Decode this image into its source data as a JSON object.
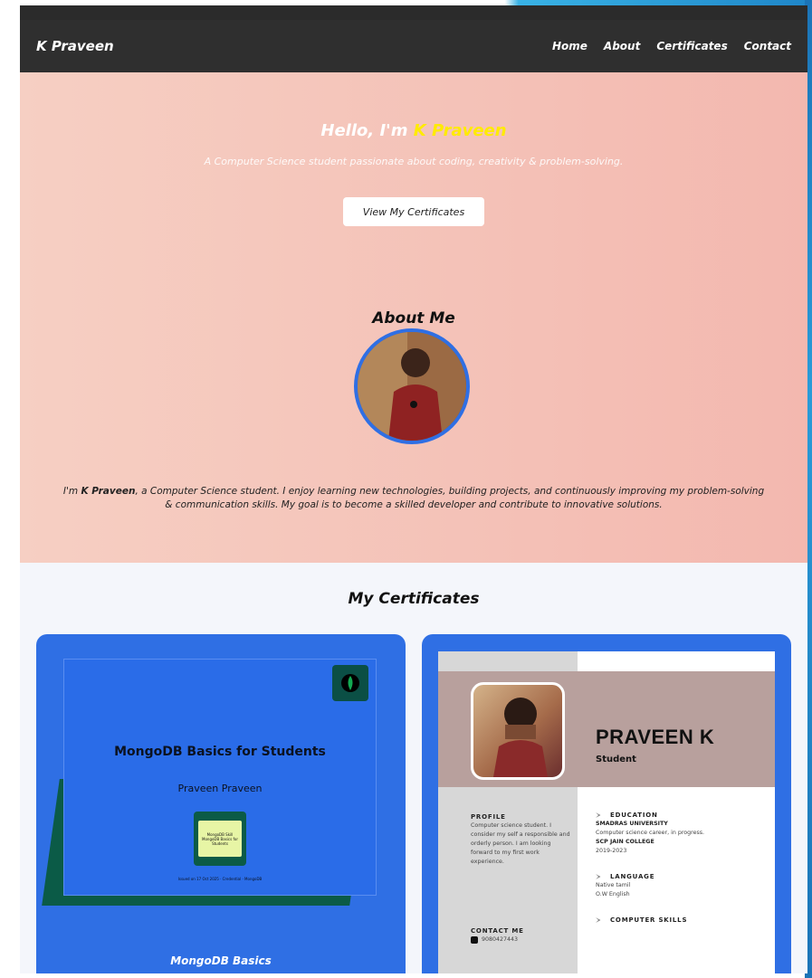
{
  "nav": {
    "brand": "K Praveen",
    "links": [
      "Home",
      "About",
      "Certificates",
      "Contact"
    ]
  },
  "hero": {
    "greeting": "Hello, I'm",
    "name": "K Praveen",
    "subtitle": "A Computer Science student passionate about coding, creativity & problem-solving.",
    "cta_label": "View My Certificates"
  },
  "about": {
    "title": "About Me",
    "text_intro": "I'm",
    "text_name": "K Praveen",
    "text_rest": ", a Computer Science student. I enjoy learning new technologies, building projects, and continuously improving my problem-solving & communication skills. My goal is to become a skilled developer and contribute to innovative solutions."
  },
  "certificates": {
    "title": "My Certificates",
    "mongo": {
      "certificate_title": "MongoDB Basics for Students",
      "recipient": "Praveen Praveen",
      "badge_header": "MongoDB Skill",
      "badge_text": "MongoDB Basics for Students",
      "fine_print": "Issued on 17 Oct 2025 · Credential · MongoDB",
      "card_label": "MongoDB Basics"
    },
    "resume": {
      "name": "PRAVEEN K",
      "role": "Student",
      "profile_heading": "PROFILE",
      "profile_text": "Computer science student. I consider my self a responsible and orderly person. I am looking forward to my first work experience.",
      "contact_heading": "CONTACT ME",
      "phone": "9080427443",
      "education_heading": "EDUCATION",
      "education_school": "SMADRAS UNIVERSITY",
      "education_desc": "Computer science career, in progress.",
      "education_college": "SCP JAIN COLLEGE",
      "education_years": "2019-2023",
      "language_heading": "LANGUAGE",
      "language_1": "Native tamil",
      "language_2": "O.W English",
      "skills_heading": "COMPUTER SKILLS"
    }
  }
}
